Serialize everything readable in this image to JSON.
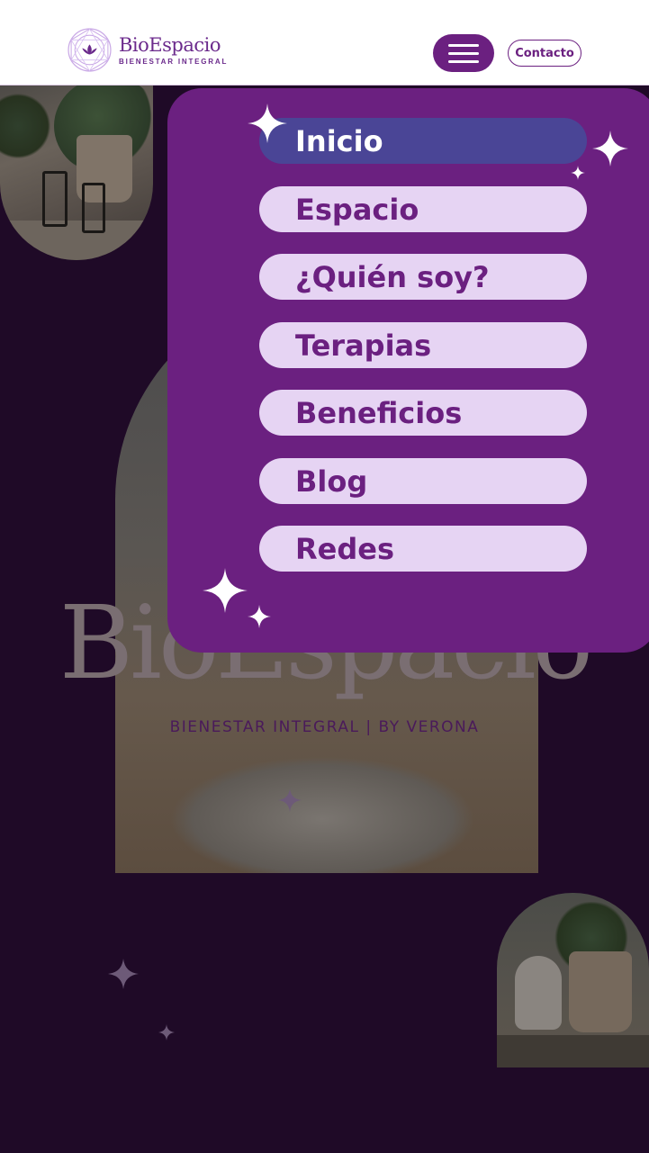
{
  "header": {
    "logo_name": "BioEspacio",
    "logo_tagline": "BIENESTAR INTEGRAL",
    "contact_label": "Contacto"
  },
  "hero": {
    "title": "BioEspacio",
    "subtitle": "BIENESTAR INTEGRAL | BY VERONA"
  },
  "menu": {
    "active_index": 0,
    "items": [
      {
        "label": "Inicio"
      },
      {
        "label": "Espacio"
      },
      {
        "label": "¿Quién soy?"
      },
      {
        "label": "Terapias"
      },
      {
        "label": "Beneficios"
      },
      {
        "label": "Blog"
      },
      {
        "label": "Redes"
      }
    ]
  },
  "colors": {
    "brand_purple": "#6b2080",
    "menu_item_bg": "#e6d4f3",
    "menu_active_bg": "#4a4596",
    "page_bg": "#1f0a27"
  },
  "icons": {
    "logo_mark": "lotus-mandala-icon",
    "menu_toggle": "hamburger-icon",
    "decor": "sparkle-icon"
  }
}
